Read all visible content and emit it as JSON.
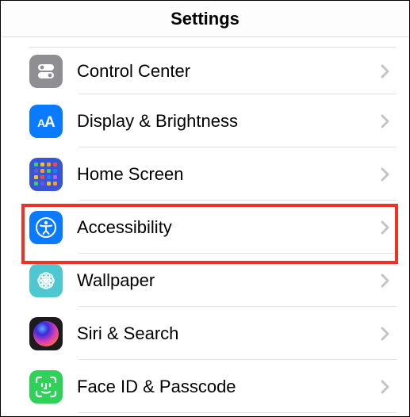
{
  "header": {
    "title": "Settings"
  },
  "rows": [
    {
      "id": "control-center",
      "label": "Control Center"
    },
    {
      "id": "display-brightness",
      "label": "Display & Brightness"
    },
    {
      "id": "home-screen",
      "label": "Home Screen"
    },
    {
      "id": "accessibility",
      "label": "Accessibility"
    },
    {
      "id": "wallpaper",
      "label": "Wallpaper"
    },
    {
      "id": "siri-search",
      "label": "Siri & Search"
    },
    {
      "id": "face-id-passcode",
      "label": "Face ID & Passcode"
    }
  ],
  "home_icon_colors": [
    "#3ad06a",
    "#fec601",
    "#ff9f0a",
    "#ff453a",
    "#5e5ce6",
    "#ff9f0a",
    "#3ad06a",
    "#0a84ff",
    "#fec601",
    "#ff453a",
    "#0a84ff",
    "#bf5af2",
    "#3ad06a",
    "#5e5ce6",
    "#fec601",
    "#ff9f0a"
  ],
  "highlighted_row": "accessibility"
}
